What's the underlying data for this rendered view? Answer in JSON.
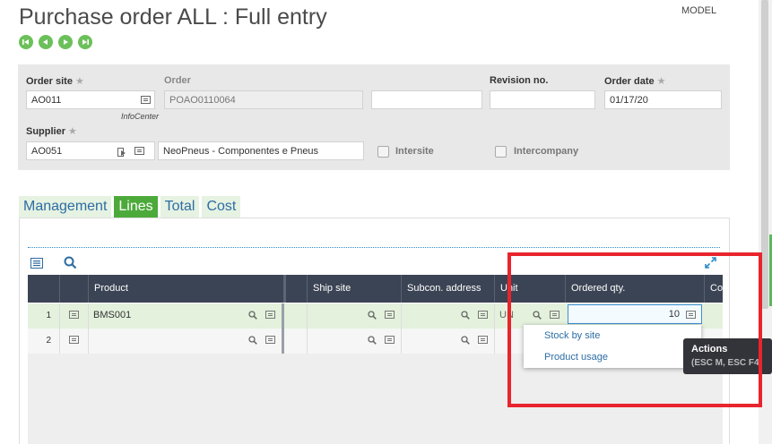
{
  "header": {
    "title": "Purchase order ALL : Full entry",
    "mode": "MODEL",
    "nav_icons": [
      "first-record-icon",
      "previous-record-icon",
      "next-record-icon",
      "last-record-icon"
    ]
  },
  "form": {
    "order_site": {
      "label": "Order site",
      "value": "AO011",
      "sub_label": "InfoCenter"
    },
    "order": {
      "label": "Order",
      "value": "POAO0110064"
    },
    "extra_field": {
      "value": ""
    },
    "revision": {
      "label": "Revision no.",
      "value": ""
    },
    "order_date": {
      "label": "Order date",
      "value": "01/17/20"
    },
    "supplier": {
      "label": "Supplier",
      "value": "AO051",
      "name": "NeoPneus - Componentes e Pneus"
    },
    "intersite": {
      "label": "Intersite",
      "checked": false
    },
    "intercompany": {
      "label": "Intercompany",
      "checked": false
    }
  },
  "tabs": [
    {
      "label": "Management",
      "active": false
    },
    {
      "label": "Lines",
      "active": true
    },
    {
      "label": "Total",
      "active": false
    },
    {
      "label": "Cost",
      "active": false
    }
  ],
  "grid": {
    "columns": [
      "Product",
      "Ship site",
      "Subcon. address",
      "Unit",
      "Ordered qty.",
      "Co"
    ],
    "rows": [
      {
        "num": "1",
        "product": "BMS001",
        "unit": "UN",
        "ordered_qty": "10"
      },
      {
        "num": "2",
        "product": "",
        "unit": "",
        "ordered_qty": ""
      }
    ]
  },
  "popup_menu": {
    "items": [
      "Stock by site",
      "Product usage"
    ]
  },
  "tooltip": {
    "title": "Actions",
    "keys": "(ESC M, ESC F4"
  },
  "colors": {
    "accent_green": "#4caa3b",
    "grid_header": "#3b4454",
    "link_blue": "#2d6da3",
    "annotation_red": "#e8242d"
  }
}
